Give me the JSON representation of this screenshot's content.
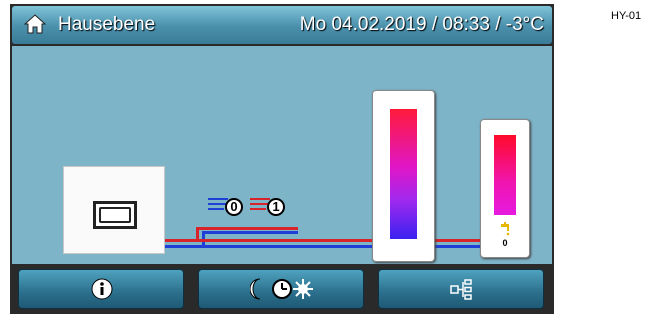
{
  "header": {
    "title": "Hausebene",
    "datetime": "Mo 04.02.2019 / 08:33 /  -3°C",
    "home_icon": "home-icon"
  },
  "side_label": "HY-01",
  "heating_circuits": [
    {
      "line_color": "#1f3fd6",
      "value": "0"
    },
    {
      "line_color": "#d8232a",
      "value": "1"
    }
  ],
  "dhw_tank": {
    "value": "0",
    "icon": "tap-icon"
  },
  "footer": {
    "buttons": [
      {
        "icon": "info-icon"
      },
      {
        "icon": "night-clock-sun-icon"
      },
      {
        "icon": "hydraulic-scheme-icon"
      }
    ]
  },
  "colors": {
    "background": "#7eb4c8",
    "flow": "#d8232a",
    "return": "#1f3fd6",
    "header": "#4a8fab"
  }
}
